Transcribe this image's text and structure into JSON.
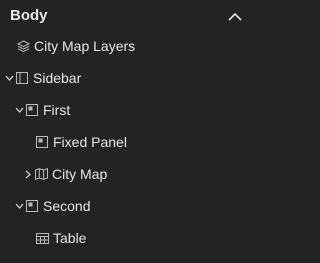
{
  "header": {
    "title": "Body",
    "collapse_icon": "chevron-up-icon"
  },
  "tree": [
    {
      "label": "City Map Layers",
      "icon": "layers-icon",
      "depth": 0,
      "expander": "none"
    },
    {
      "label": "Sidebar",
      "icon": "sidebar-panel-icon",
      "depth": 0,
      "expander": "expanded"
    },
    {
      "label": "First",
      "icon": "panel-icon",
      "depth": 1,
      "expander": "expanded"
    },
    {
      "label": "Fixed Panel",
      "icon": "panel-icon",
      "depth": 2,
      "expander": "none"
    },
    {
      "label": "City Map",
      "icon": "map-icon",
      "depth": 2,
      "expander": "collapsed"
    },
    {
      "label": "Second",
      "icon": "panel-icon",
      "depth": 1,
      "expander": "expanded"
    },
    {
      "label": "Table",
      "icon": "table-icon",
      "depth": 2,
      "expander": "none"
    }
  ],
  "colors": {
    "background": "#232323",
    "text": "#e6e6e6",
    "icon": "#bdbdbd"
  }
}
